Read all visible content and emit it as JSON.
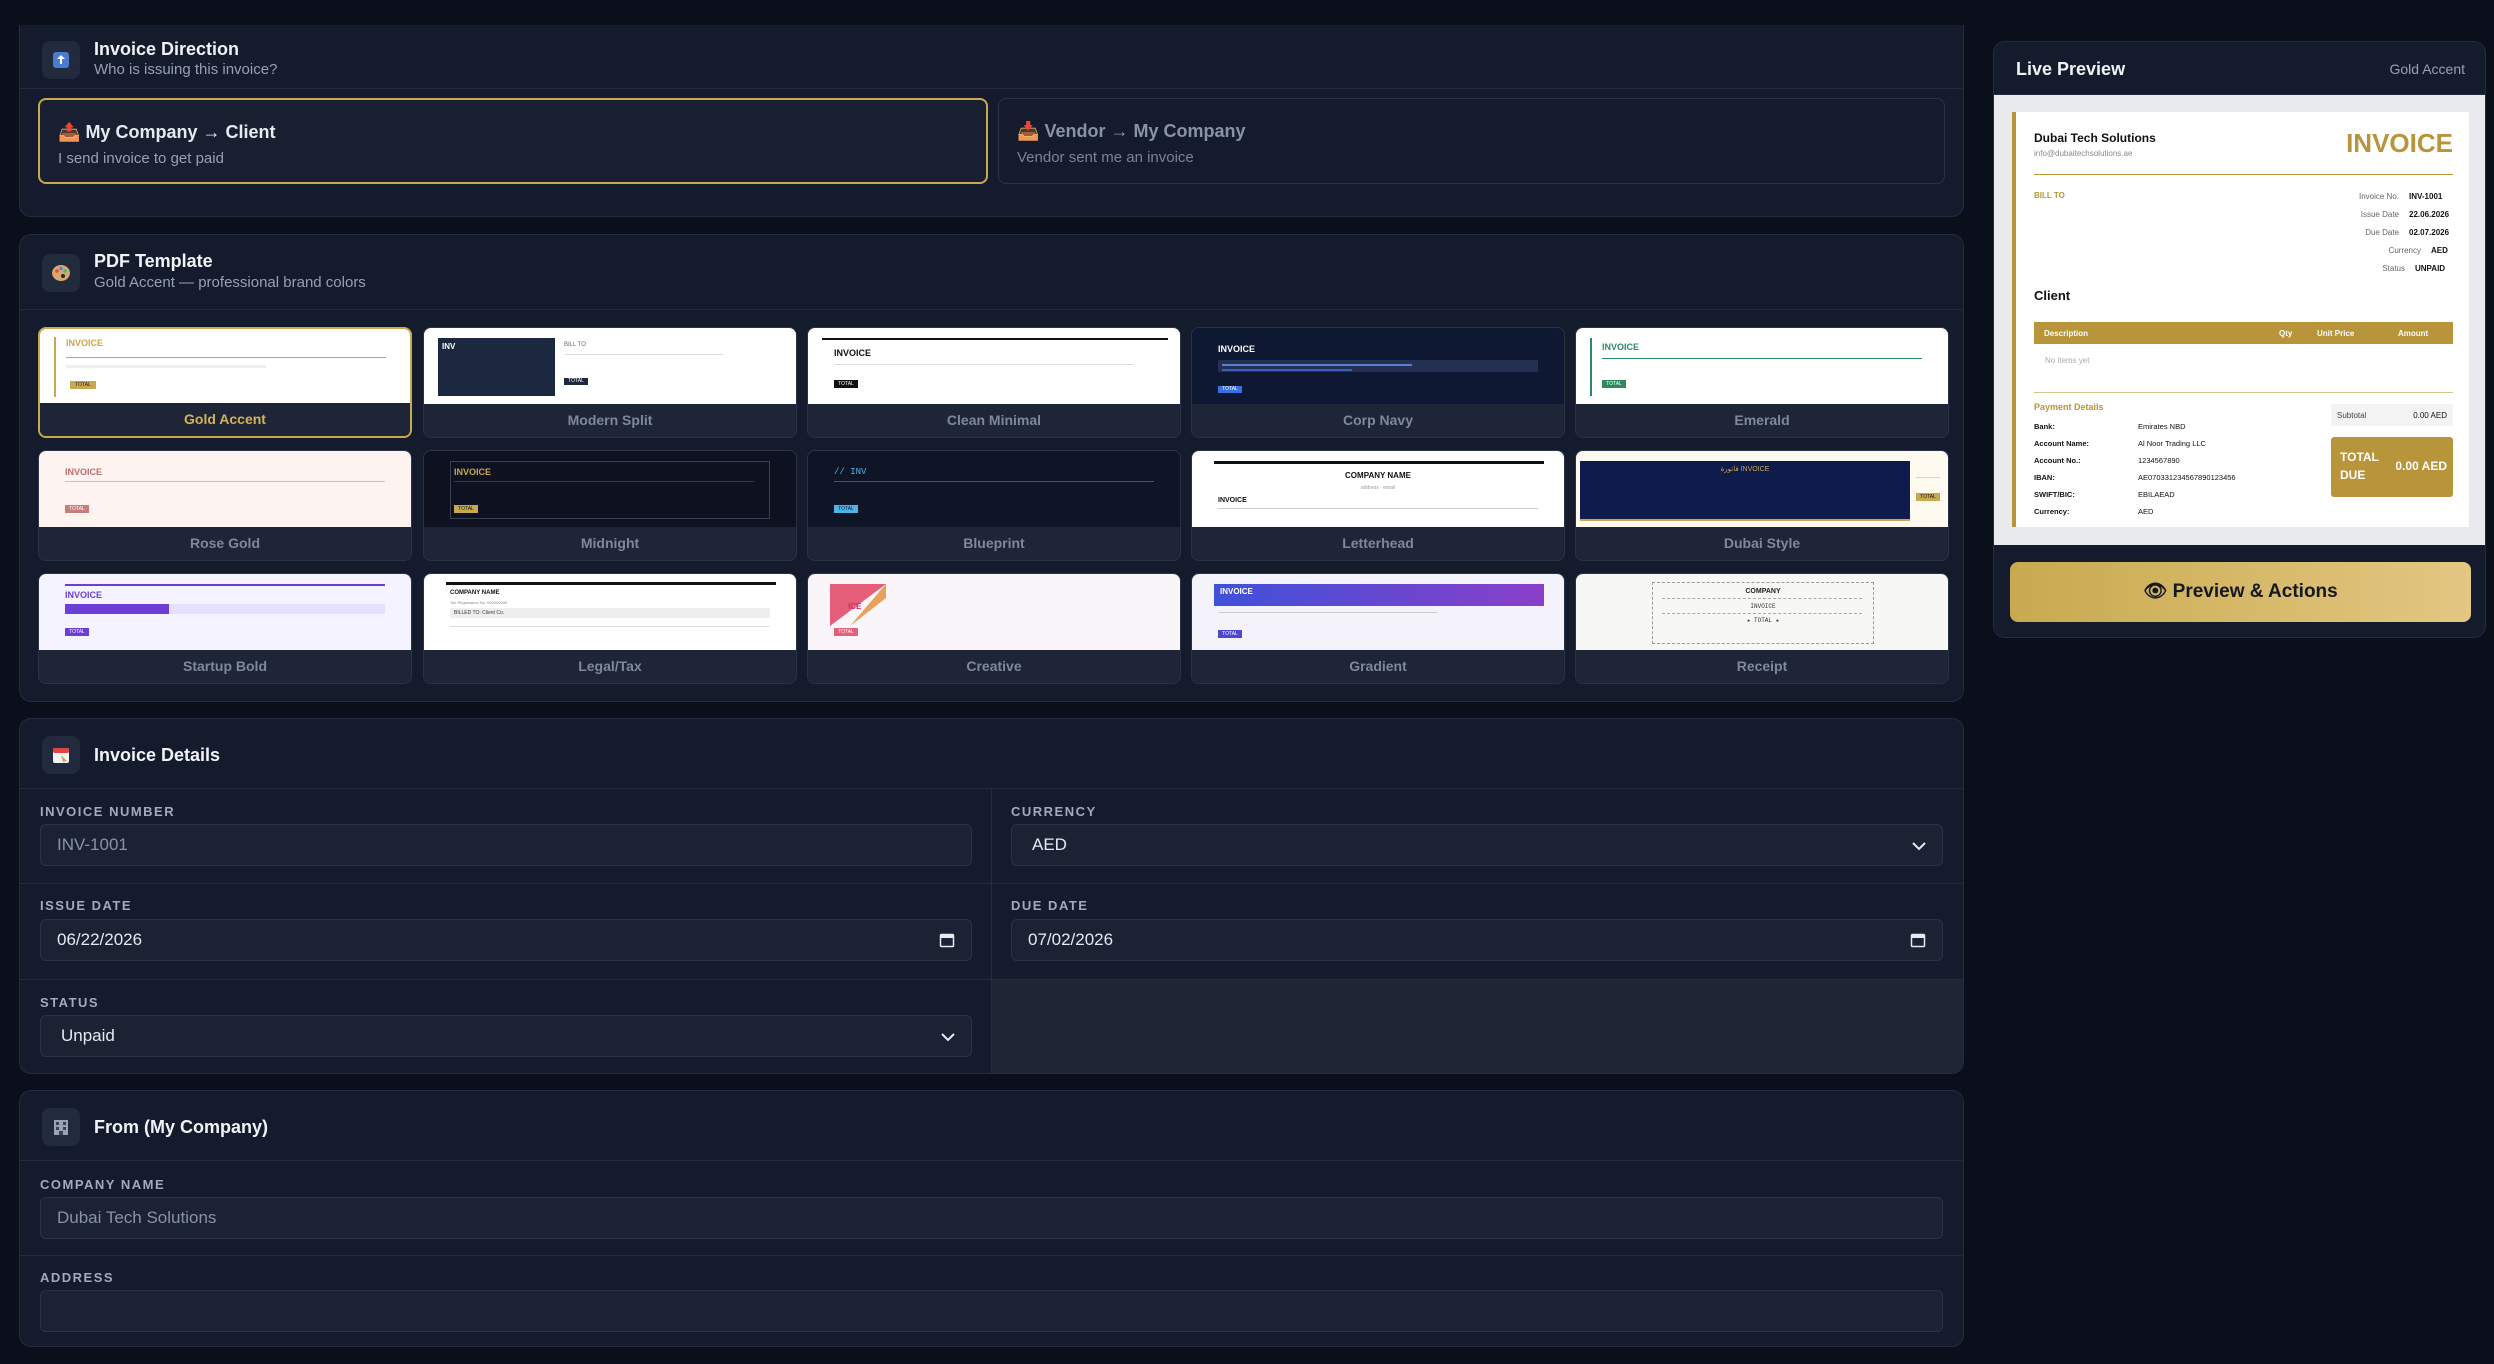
{
  "direction": {
    "title": "Invoice Direction",
    "subtitle": "Who is issuing this invoice?",
    "icon": "upload-tray-icon",
    "options": [
      {
        "emoji": "📤",
        "title": "My Company → Client",
        "subtitle": "I send invoice to get paid"
      },
      {
        "emoji": "📥",
        "title": "Vendor → My Company",
        "subtitle": "Vendor sent me an invoice"
      }
    ]
  },
  "pdf_template": {
    "title": "PDF Template",
    "subtitle": "Gold Accent — professional brand colors",
    "icon": "palette-icon",
    "templates": [
      "Gold Accent",
      "Modern Split",
      "Clean Minimal",
      "Corp Navy",
      "Emerald",
      "Rose Gold",
      "Midnight",
      "Blueprint",
      "Letterhead",
      "Dubai Style",
      "Startup Bold",
      "Legal/Tax",
      "Creative",
      "Gradient",
      "Receipt"
    ],
    "thumb_text": {
      "invoice": "INVOICE",
      "inv": "INV",
      "inv_code": "// INV",
      "total": "TOTAL",
      "bill_to": "BILL TO",
      "company_name_caps": "COMPANY NAME",
      "company_name": "COMPANY NAME",
      "address_email": "address · email",
      "tax_reg": "Tax Registration No: 000000000",
      "billed_to": "BILLED TO: Client Co.",
      "company": "COMPANY",
      "invoice_mono": "INVOICE",
      "total_mono": "★ TOTAL ★",
      "dubai_invoice": "فاتورة INVOICE",
      "creative_ice": "ICE"
    }
  },
  "details": {
    "title": "Invoice Details",
    "icon": "calendar-icon",
    "invoice_number_label": "INVOICE NUMBER",
    "invoice_number_placeholder": "INV-1001",
    "currency_label": "CURRENCY",
    "currency_value": "AED",
    "issue_date_label": "ISSUE DATE",
    "issue_date_value": "06/22/2026",
    "due_date_label": "DUE DATE",
    "due_date_value": "07/02/2026",
    "status_label": "STATUS",
    "status_value": "Unpaid"
  },
  "from": {
    "title": "From (My Company)",
    "icon": "building-icon",
    "company_name_label": "COMPANY NAME",
    "company_name_placeholder": "Dubai Tech Solutions",
    "address_label": "ADDRESS",
    "address_value": ""
  },
  "preview": {
    "title": "Live Preview",
    "template_name": "Gold Accent",
    "button_label": "👁 Preview & Actions",
    "doc": {
      "company": "Dubai Tech Solutions",
      "email": "info@dubaitechsolutions.ae",
      "heading": "INVOICE",
      "bill_to": "BILL TO",
      "client": "Client",
      "meta": [
        {
          "k": "Invoice No.",
          "v": "INV-1001"
        },
        {
          "k": "Issue Date",
          "v": "22.06.2026"
        },
        {
          "k": "Due Date",
          "v": "02.07.2026"
        },
        {
          "k": "Currency",
          "v": "AED"
        },
        {
          "k": "Status",
          "v": "UNPAID"
        }
      ],
      "columns": [
        "Description",
        "Qty",
        "Unit Price",
        "Amount"
      ],
      "no_items": "No items yet",
      "payment_details": "Payment Details",
      "payment": [
        {
          "k": "Bank:",
          "v": "Emirates NBD"
        },
        {
          "k": "Account Name:",
          "v": "Al Noor Trading LLC"
        },
        {
          "k": "Account No.:",
          "v": "1234567890"
        },
        {
          "k": "IBAN:",
          "v": "AE070331234567890123456"
        },
        {
          "k": "SWIFT/BIC:",
          "v": "EBILAEAD"
        },
        {
          "k": "Currency:",
          "v": "AED"
        }
      ],
      "subtotal_label": "Subtotal",
      "subtotal_value": "0.00 AED",
      "total_label_1": "TOTAL",
      "total_label_2": "DUE",
      "total_value": "0.00 AED"
    }
  },
  "colors": {
    "accent": "#c9a94f",
    "background": "#0b0f1c",
    "card": "#141b2c"
  }
}
